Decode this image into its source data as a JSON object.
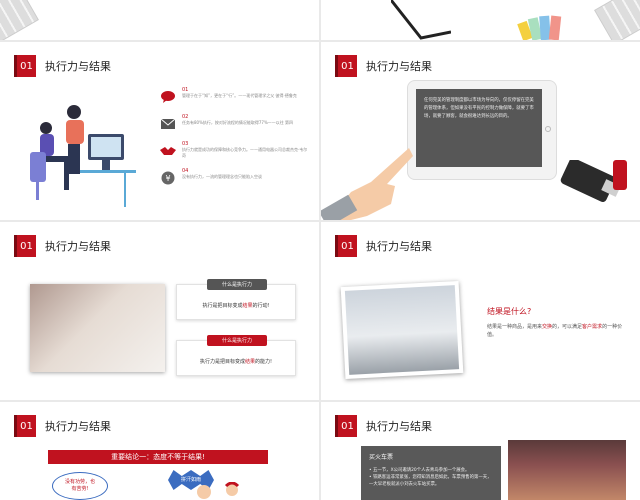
{
  "section_number": "01",
  "section_title": "执行力与结果",
  "slide1": {
    "items": [
      {
        "icon": "chat-icon",
        "num": "01",
        "text": "管理于在于“知”，更在于“行”。——现代管理学之父 彼得·德鲁克"
      },
      {
        "icon": "mail-icon",
        "num": "02",
        "text": "任务有80%执行，按对好流程的情况能取得77%——以往 第四"
      },
      {
        "icon": "handshake-icon",
        "num": "03",
        "text": "执行力就是成功的保障和核心竞争力。——通用电器公司总裁杰克·韦尔奇"
      },
      {
        "icon": "coin-icon",
        "num": "04",
        "text": "没有执行力，一流的管理理念也只能陷入空谈"
      }
    ]
  },
  "slide2": {
    "screen_text": "任何完美的管理制度都以市场为导向的，仅仅停留在完美的管理体系，但如果没有平民的控制力做保障，就要了市场，就要了顾客，就会很难达到长远的目的。"
  },
  "slide3": {
    "cards": [
      {
        "pill": "什么是执行力",
        "text_a": "执行是把目标变成",
        "highlight": "结果",
        "text_b": "的行动!"
      },
      {
        "pill": "什么是执行力",
        "text_a": "执行力是把目标变成",
        "highlight": "结果",
        "text_b": "的能力!"
      }
    ]
  },
  "slide4": {
    "title": "结果是什么?",
    "body_a": "结果是一种商品，是用来",
    "highlight_1": "交换",
    "body_b": "的，可以满足",
    "highlight_2": "客户需求",
    "body_c": "的一种价值。"
  },
  "slide5": {
    "banner": "重要结论一：态度不等于结果!",
    "cloud_line1": "没有功劳，也",
    "cloud_line2": "有苦劳!",
    "burst": "拼汗如雨"
  },
  "slide6": {
    "box_title": "买火车票",
    "bullets": [
      "五一节，X公司邀请20个人去青岛参加一个展会。",
      "铁路客运非常紧张，您得知消息后如此，车票预售的第一天，一大早老板就派小刘去火车站买票。"
    ]
  },
  "colors": {
    "accent": "#c0121f",
    "dark_panel": "#575757",
    "blue": "#3b6cc0"
  }
}
